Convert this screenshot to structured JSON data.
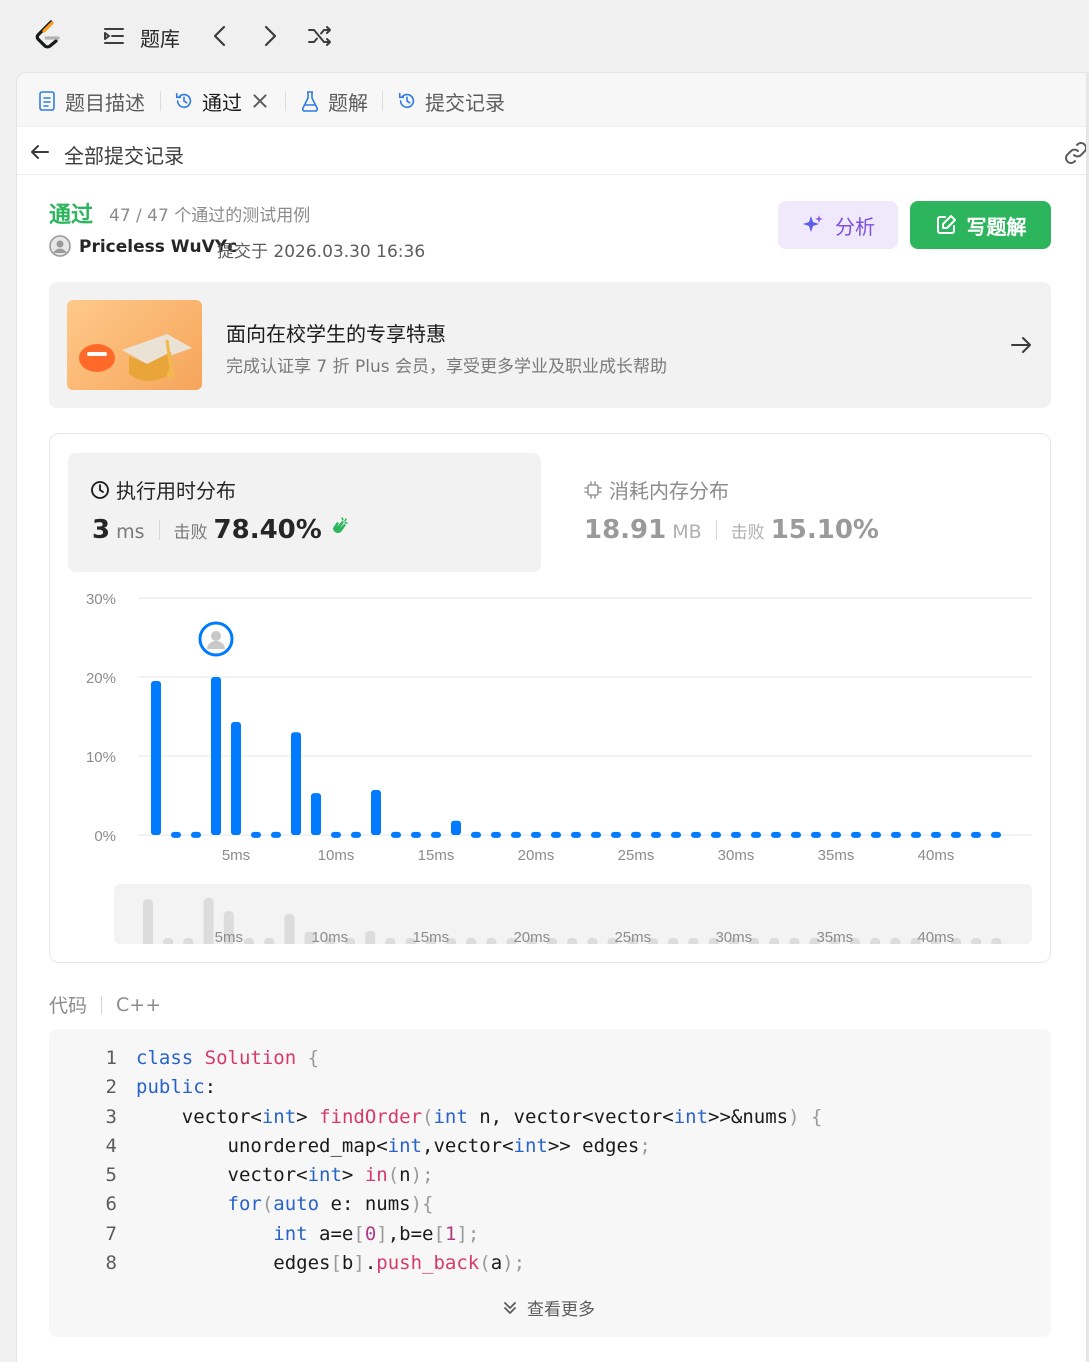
{
  "topbar": {
    "title": "题库",
    "icons": [
      "leetcode-logo",
      "list-icon",
      "chevron-left-icon",
      "chevron-right-icon",
      "shuffle-icon"
    ]
  },
  "tabs": [
    {
      "label": "题目描述",
      "icon": "description-icon"
    },
    {
      "label": "通过",
      "icon": "history-icon",
      "active": true
    },
    {
      "label": "题解",
      "icon": "flask-icon"
    },
    {
      "label": "提交记录",
      "icon": "history-icon"
    }
  ],
  "back": {
    "label": "全部提交记录"
  },
  "result": {
    "status": "通过",
    "cases": "47 / 47 个通过的测试用例",
    "username": "Priceless WuVYc",
    "submitted": "提交于 2026.03.30 16:36",
    "analyze_label": "分析",
    "write_label": "写题解"
  },
  "promo": {
    "title": "面向在校学生的专享特惠",
    "subtitle": "完成认证享 7 折 Plus 会员，享受更多学业及职业成长帮助"
  },
  "runtime": {
    "title": "执行用时分布",
    "value": "3",
    "unit": "ms",
    "beat_label": "击败",
    "beat_value": "78.40%"
  },
  "memory": {
    "title": "消耗内存分布",
    "value": "18.91",
    "unit": "MB",
    "beat_label": "击败",
    "beat_value": "15.10%"
  },
  "chart_data": {
    "type": "bar",
    "x": [
      1,
      2,
      3,
      4,
      5,
      6,
      7,
      8,
      9,
      10,
      11,
      12,
      13,
      14,
      15,
      16,
      17,
      18,
      19,
      20,
      21,
      22,
      23,
      24,
      25,
      26,
      27,
      28,
      29,
      30,
      31,
      32,
      33,
      34,
      35,
      36,
      37,
      38,
      39,
      40,
      41,
      42,
      43
    ],
    "values": [
      19.5,
      0.4,
      0.4,
      20,
      14.3,
      0.4,
      0.4,
      13,
      5.3,
      0.4,
      0.4,
      5.7,
      0.4,
      0.4,
      0.4,
      1.8,
      0.4,
      0.4,
      0.4,
      0.4,
      0.4,
      0.4,
      0.4,
      0.4,
      0.4,
      0.4,
      0.4,
      0.4,
      0.4,
      0.4,
      0.4,
      0.4,
      0.4,
      0.4,
      0.4,
      0.4,
      0.4,
      0.4,
      0.4,
      0.4,
      0.4,
      0.4,
      0.4
    ],
    "ylim": [
      0,
      30
    ],
    "yticks": [
      "30%",
      "20%",
      "10%",
      "0%"
    ],
    "xticks": [
      "5ms",
      "10ms",
      "15ms",
      "20ms",
      "25ms",
      "30ms",
      "35ms",
      "40ms"
    ],
    "highlight_x": 4,
    "grid": true,
    "bar_color": "#007aff"
  },
  "code": {
    "label": "代码",
    "language": "C++",
    "more_label": "查看更多",
    "lines": [
      "class Solution {",
      "public:",
      "    vector<int> findOrder(int n, vector<vector<int>>&nums) {",
      "        unordered_map<int,vector<int>> edges;",
      "        vector<int> in(n);",
      "        for(auto e: nums){",
      "            int a=e[0],b=e[1];",
      "            edges[b].push_back(a);"
    ]
  },
  "colors": {
    "accepted": "#2db55d",
    "accent": "#007aff",
    "analyze": "#7b4fe0"
  }
}
